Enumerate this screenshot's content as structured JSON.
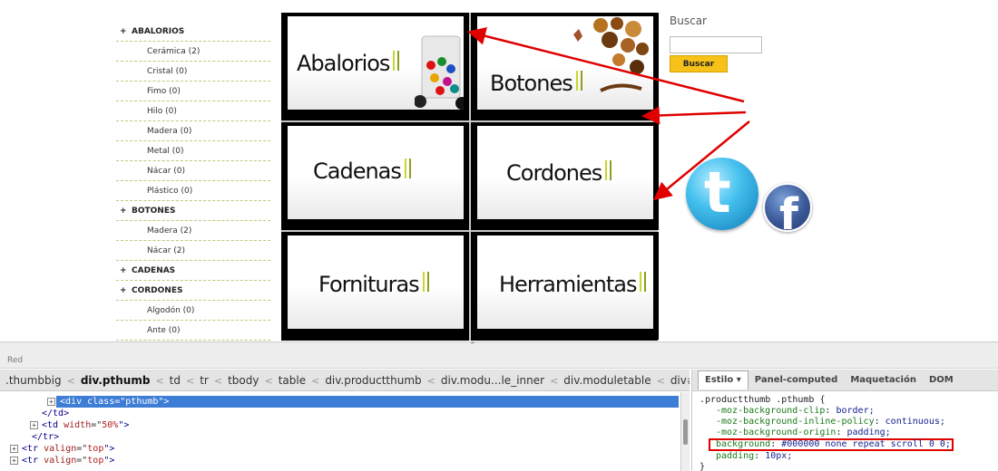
{
  "sidebar": {
    "categories": [
      {
        "name": "ABALORIOS",
        "items": [
          "Cerámica (2)",
          "Cristal (0)",
          "Fimo (0)",
          "Hilo (0)",
          "Madera (0)",
          "Metal (0)",
          "Nácar (0)",
          "Plástico (0)"
        ]
      },
      {
        "name": "BOTONES",
        "items": [
          "Madera (2)",
          "Nácar (2)"
        ]
      },
      {
        "name": "CADENAS",
        "items": []
      },
      {
        "name": "CORDONES",
        "items": [
          "Algodón (0)",
          "Ante (0)"
        ]
      }
    ],
    "expand_symbol": "+"
  },
  "grid": {
    "tiles": [
      {
        "title": "Abalorios"
      },
      {
        "title": "Botones"
      },
      {
        "title": "Cadenas"
      },
      {
        "title": "Cordones"
      },
      {
        "title": "Fornituras"
      },
      {
        "title": "Herramientas"
      }
    ]
  },
  "search": {
    "label": "Buscar",
    "input_value": "",
    "button_label": "Buscar"
  },
  "colors": {
    "arrow": "#e00000",
    "accent_bar_light": "#c9d62b",
    "accent_bar_dark": "#8aa01e",
    "search_button": "#f6c21a",
    "selection": "#3d7dd6",
    "twitter": "#45c1ee",
    "facebook": "#3b5998"
  },
  "social": {
    "twitter_glyph": "t",
    "facebook_glyph": "f"
  },
  "devtools": {
    "panel_label": "Red",
    "breadcrumb": [
      ".thumbbig",
      "div.pthumb",
      "td",
      "tr",
      "tbody",
      "table",
      "div.productthumb",
      "div.modu...le_inner",
      "div.moduletable",
      "div#vmMainPage"
    ],
    "breadcrumb_active_index": 1,
    "breadcrumb_separator": "<",
    "dom_lines": [
      {
        "indent": 4,
        "exp": "+",
        "tag": "div",
        "attr": "class",
        "value": "pthumb",
        "closing": false,
        "selected": true
      },
      {
        "indent": 3,
        "exp": "",
        "text": "</td>",
        "selected": false
      },
      {
        "indent": 3,
        "exp": "+",
        "tag": "td",
        "attr": "width",
        "value": "50%",
        "closing": false,
        "selected": false
      },
      {
        "indent": 2,
        "exp": "",
        "text": "</tr>",
        "selected": false
      },
      {
        "indent": 1,
        "exp": "+",
        "tag": "tr",
        "attr": "valign",
        "value": "top",
        "closing": false,
        "selected": false
      },
      {
        "indent": 1,
        "exp": "+",
        "tag": "tr",
        "attr": "valign",
        "value": "top",
        "closing": false,
        "selected": false
      }
    ],
    "style_tabs": [
      "Estilo ▾",
      "Panel-computed",
      "Maquetación",
      "DOM"
    ],
    "css_rule": {
      "selector": ".productthumb .pthumb {",
      "declarations": [
        {
          "prop": "-moz-background-clip",
          "value": "border;",
          "highlight": false
        },
        {
          "prop": "-moz-background-inline-policy",
          "value": "continuous;",
          "highlight": false
        },
        {
          "prop": "-moz-background-origin",
          "value": "padding;",
          "highlight": false
        },
        {
          "prop": "background",
          "value": "#000000 none repeat scroll 0 0;",
          "highlight": true
        },
        {
          "prop": "padding",
          "value": "10px;",
          "highlight": false
        }
      ],
      "close": "}"
    }
  }
}
